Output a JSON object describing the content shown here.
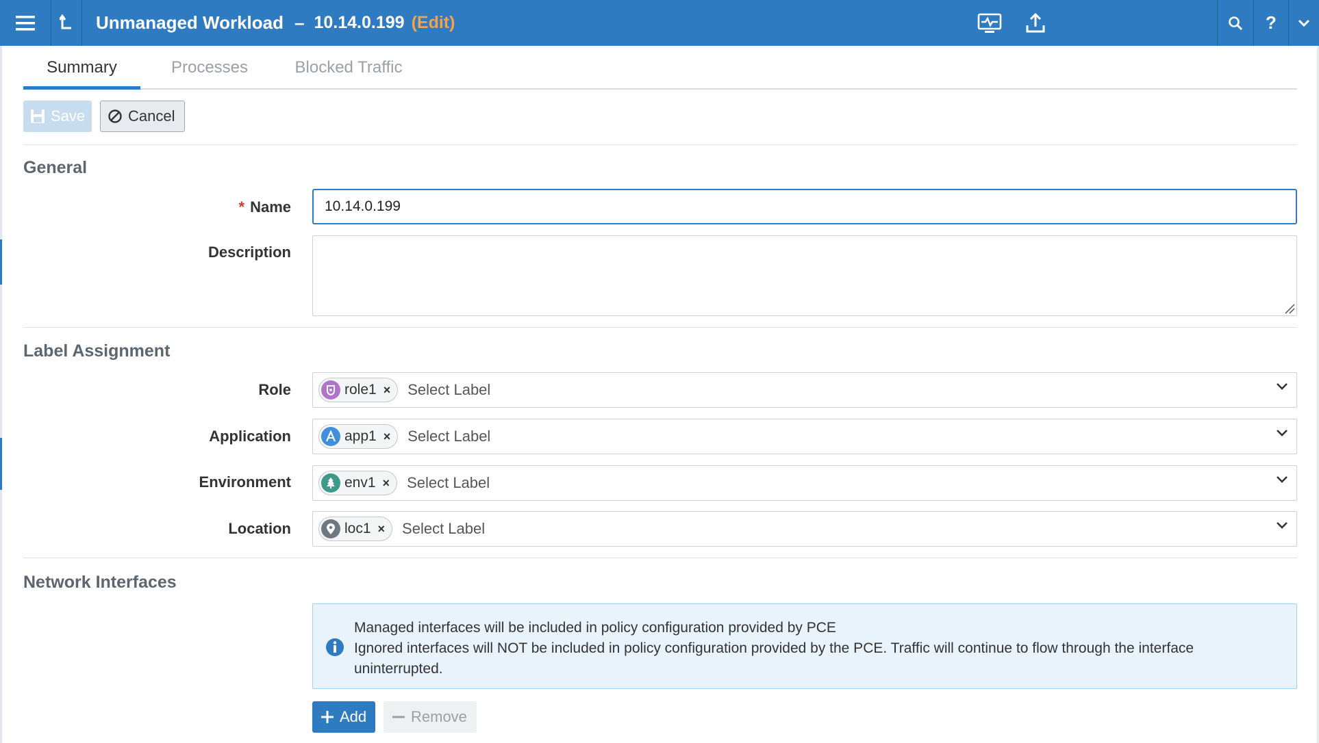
{
  "header": {
    "menu_icon": "hamburger-icon",
    "back_icon": "return-up-icon",
    "title": "Unmanaged Workload",
    "separator": "–",
    "host": "10.14.0.199",
    "mode": "(Edit)",
    "actions": [
      "monitor-icon",
      "upload-icon",
      "search-icon",
      "help-icon",
      "chevron-down-icon"
    ],
    "help_glyph": "?"
  },
  "tabs": [
    {
      "label": "Summary",
      "active": true
    },
    {
      "label": "Processes",
      "active": false
    },
    {
      "label": "Blocked Traffic",
      "active": false
    }
  ],
  "toolbar": {
    "save_label": "Save",
    "cancel_label": "Cancel"
  },
  "general": {
    "title": "General",
    "name_required_mark": "*",
    "name_label": "Name",
    "name_value": "10.14.0.199",
    "description_label": "Description",
    "description_value": ""
  },
  "labels": {
    "title": "Label Assignment",
    "placeholder": "Select Label",
    "rows": [
      {
        "field": "Role",
        "chip": "role1",
        "icon": "role-icon",
        "color": "#b074c9"
      },
      {
        "field": "Application",
        "chip": "app1",
        "icon": "application-icon",
        "color": "#3f8fdd"
      },
      {
        "field": "Environment",
        "chip": "env1",
        "icon": "environment-tree-icon",
        "color": "#3d9a8b"
      },
      {
        "field": "Location",
        "chip": "loc1",
        "icon": "location-pin-icon",
        "color": "#6e7882"
      }
    ],
    "remove_glyph": "×"
  },
  "network": {
    "title": "Network Interfaces",
    "info_line1": "Managed interfaces will be included in policy configuration provided by PCE",
    "info_line2": "Ignored interfaces will NOT be included in policy configuration provided by the PCE. Traffic will continue to flow through the interface uninterrupted.",
    "add_label": "Add",
    "remove_label": "Remove"
  },
  "colors": {
    "brand": "#2f7bc1",
    "edit_accent": "#f5a24b",
    "required": "#d9372b"
  }
}
